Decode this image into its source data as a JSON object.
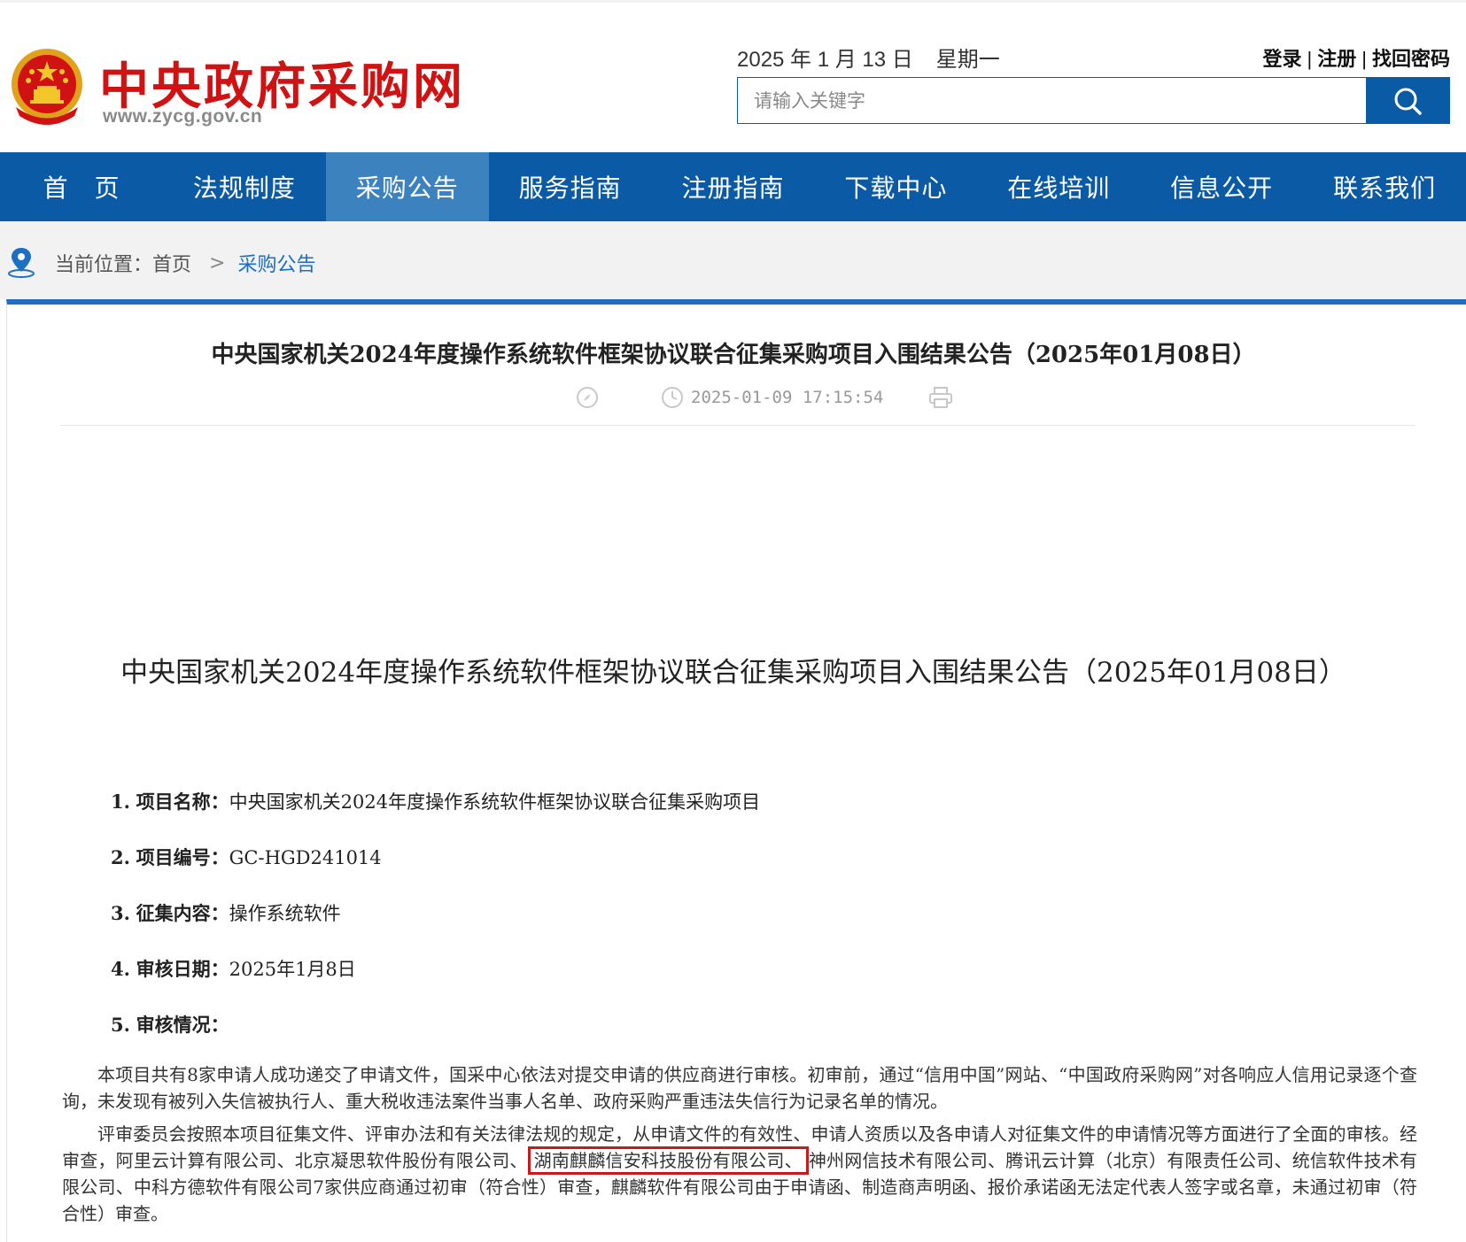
{
  "header": {
    "logo_title": "中央政府采购网",
    "logo_url": "www.zycg.gov.cn",
    "date": "2025 年 1 月 13 日",
    "weekday": "星期一",
    "login": "登录",
    "register": "注册",
    "recover": "找回密码",
    "search_placeholder": "请输入关键字"
  },
  "nav": {
    "items": [
      "首　页",
      "法规制度",
      "采购公告",
      "服务指南",
      "注册指南",
      "下载中心",
      "在线培训",
      "信息公开",
      "联系我们"
    ],
    "active": "采购公告"
  },
  "breadcrumb": {
    "label": "当前位置：",
    "home": "首页",
    "arrow": ">",
    "current": "采购公告"
  },
  "article": {
    "title": "中央国家机关2024年度操作系统软件框架协议联合征集采购项目入围结果公告（2025年01月08日）",
    "datetime": "2025-01-09 17:15:54",
    "body_title": "中央国家机关2024年度操作系统软件框架协议联合征集采购项目入围结果公告（2025年01月08日）",
    "items": [
      {
        "num": "1.",
        "label": "项目名称：",
        "value": "中央国家机关2024年度操作系统软件框架协议联合征集采购项目"
      },
      {
        "num": "2.",
        "label": "项目编号：",
        "value": "GC-HGD241014"
      },
      {
        "num": "3.",
        "label": "征集内容：",
        "value": "操作系统软件"
      },
      {
        "num": "4.",
        "label": "审核日期：",
        "value": "2025年1月8日"
      },
      {
        "num": "5.",
        "label": "审核情况：",
        "value": ""
      }
    ],
    "para1": "本项目共有8家申请人成功递交了申请文件，国采中心依法对提交申请的供应商进行审核。初审前，通过“信用中国”网站、“中国政府采购网”对各响应人信用记录逐个查询，未发现有被列入失信被执行人、重大税收违法案件当事人名单、政府采购严重违法失信行为记录名单的情况。",
    "para2_before": "评审委员会按照本项目征集文件、评审办法和有关法律法规的规定，从申请文件的有效性、申请人资质以及各申请人对征集文件的申请情况等方面进行了全面的审核。经审查，阿里云计算有限公司、北京凝思软件股份有限公司、",
    "para2_highlight": "湖南麒麟信安科技股份有限公司、",
    "para2_after": "神州网信技术有限公司、腾讯云计算（北京）有限责任公司、统信软件技术有限公司、中科方德软件有限公司7家供应商通过初审（符合性）审查，麒麟软件有限公司由于申请函、制造商声明函、报价承诺函无法定代表人签字或名章，未通过初审（符合性）审查。",
    "highlight_color": "#c8191b"
  },
  "colors": {
    "brand_red": "#d11212",
    "nav_blue": "#0a5aa5",
    "nav_active": "#3b82bf",
    "link_blue": "#1a6fc4"
  }
}
